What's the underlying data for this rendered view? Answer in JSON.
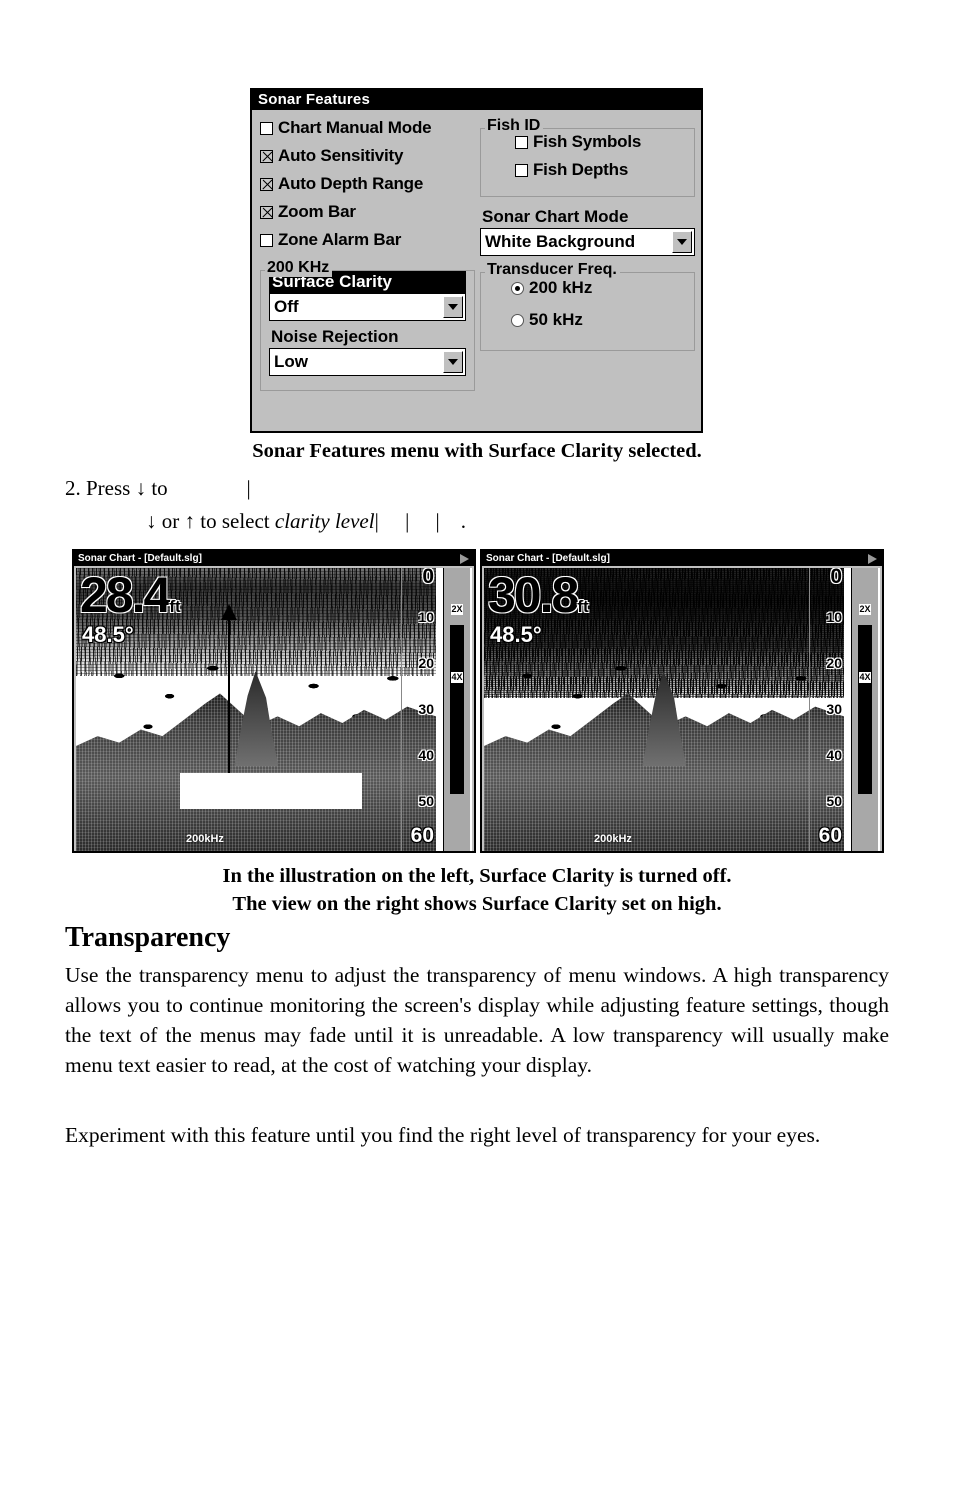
{
  "dialog": {
    "title": "Sonar Features",
    "checkboxes": [
      {
        "label": "Chart Manual Mode",
        "checked": false
      },
      {
        "label": "Auto Sensitivity",
        "checked": true
      },
      {
        "label": "Auto Depth Range",
        "checked": true
      },
      {
        "label": "Zoom Bar",
        "checked": true
      },
      {
        "label": "Zone Alarm Bar",
        "checked": false
      }
    ],
    "khz_group": {
      "legend": "200 KHz",
      "surface_clarity_label": "Surface Clarity",
      "surface_clarity_value": "Off",
      "noise_rejection_label": "Noise Rejection",
      "noise_rejection_value": "Low"
    },
    "fish_id_group": {
      "legend": "Fish ID",
      "items": [
        {
          "label": "Fish Symbols",
          "checked": false
        },
        {
          "label": "Fish Depths",
          "checked": false
        }
      ]
    },
    "sonar_chart_mode": {
      "label": "Sonar Chart Mode",
      "value": "White Background"
    },
    "transducer_freq": {
      "legend": "Transducer Freq.",
      "options": [
        {
          "label": "200 kHz",
          "selected": true
        },
        {
          "label": "50 kHz",
          "selected": false
        }
      ]
    }
  },
  "figure1_caption": "Sonar Features menu with Surface Clarity selected.",
  "step": {
    "line1_prefix": "2. Press ",
    "line1_arrow": "↓",
    "line1_mid": " to",
    "line1_bar": "|",
    "line2_arrow_down": "↓",
    "line2_or": " or ",
    "line2_arrow_up": "↑",
    "line2_text": " to select ",
    "line2_italic": "clarity level",
    "line2_bar1": "|",
    "line2_bar2": "|",
    "line2_bar3": "|",
    "line2_period": "."
  },
  "sonar_left": {
    "title": "Sonar Chart - [Default.slg]",
    "depth": "28.4",
    "unit": "ft",
    "temperature": "48.5°",
    "frequency": "200kHz",
    "depth_scale": [
      "0",
      "10",
      "20",
      "30",
      "40",
      "50",
      "60"
    ],
    "zoom_marks": [
      "2X",
      "4X"
    ]
  },
  "sonar_right": {
    "title": "Sonar Chart - [Default.slg]",
    "depth": "30.8",
    "unit": "ft",
    "temperature": "48.5°",
    "frequency": "200kHz",
    "depth_scale": [
      "0",
      "10",
      "20",
      "30",
      "40",
      "50",
      "60"
    ],
    "zoom_marks": [
      "2X",
      "4X"
    ]
  },
  "figure2_caption_line1": "In the illustration on the left, Surface Clarity is turned off.",
  "figure2_caption_line2": "The view on the right shows Surface Clarity set on high.",
  "section": {
    "heading": "Transparency",
    "paragraph1": "Use the transparency menu to adjust the transparency of menu windows. A high transparency allows you to continue monitoring the screen's display while adjusting feature settings, though the text of the menus may fade until it is unreadable. A low transparency will usually make menu text easier to read, at the cost of watching your display.",
    "paragraph2": "Experiment with this feature until you find the right level of transparency for your eyes."
  }
}
